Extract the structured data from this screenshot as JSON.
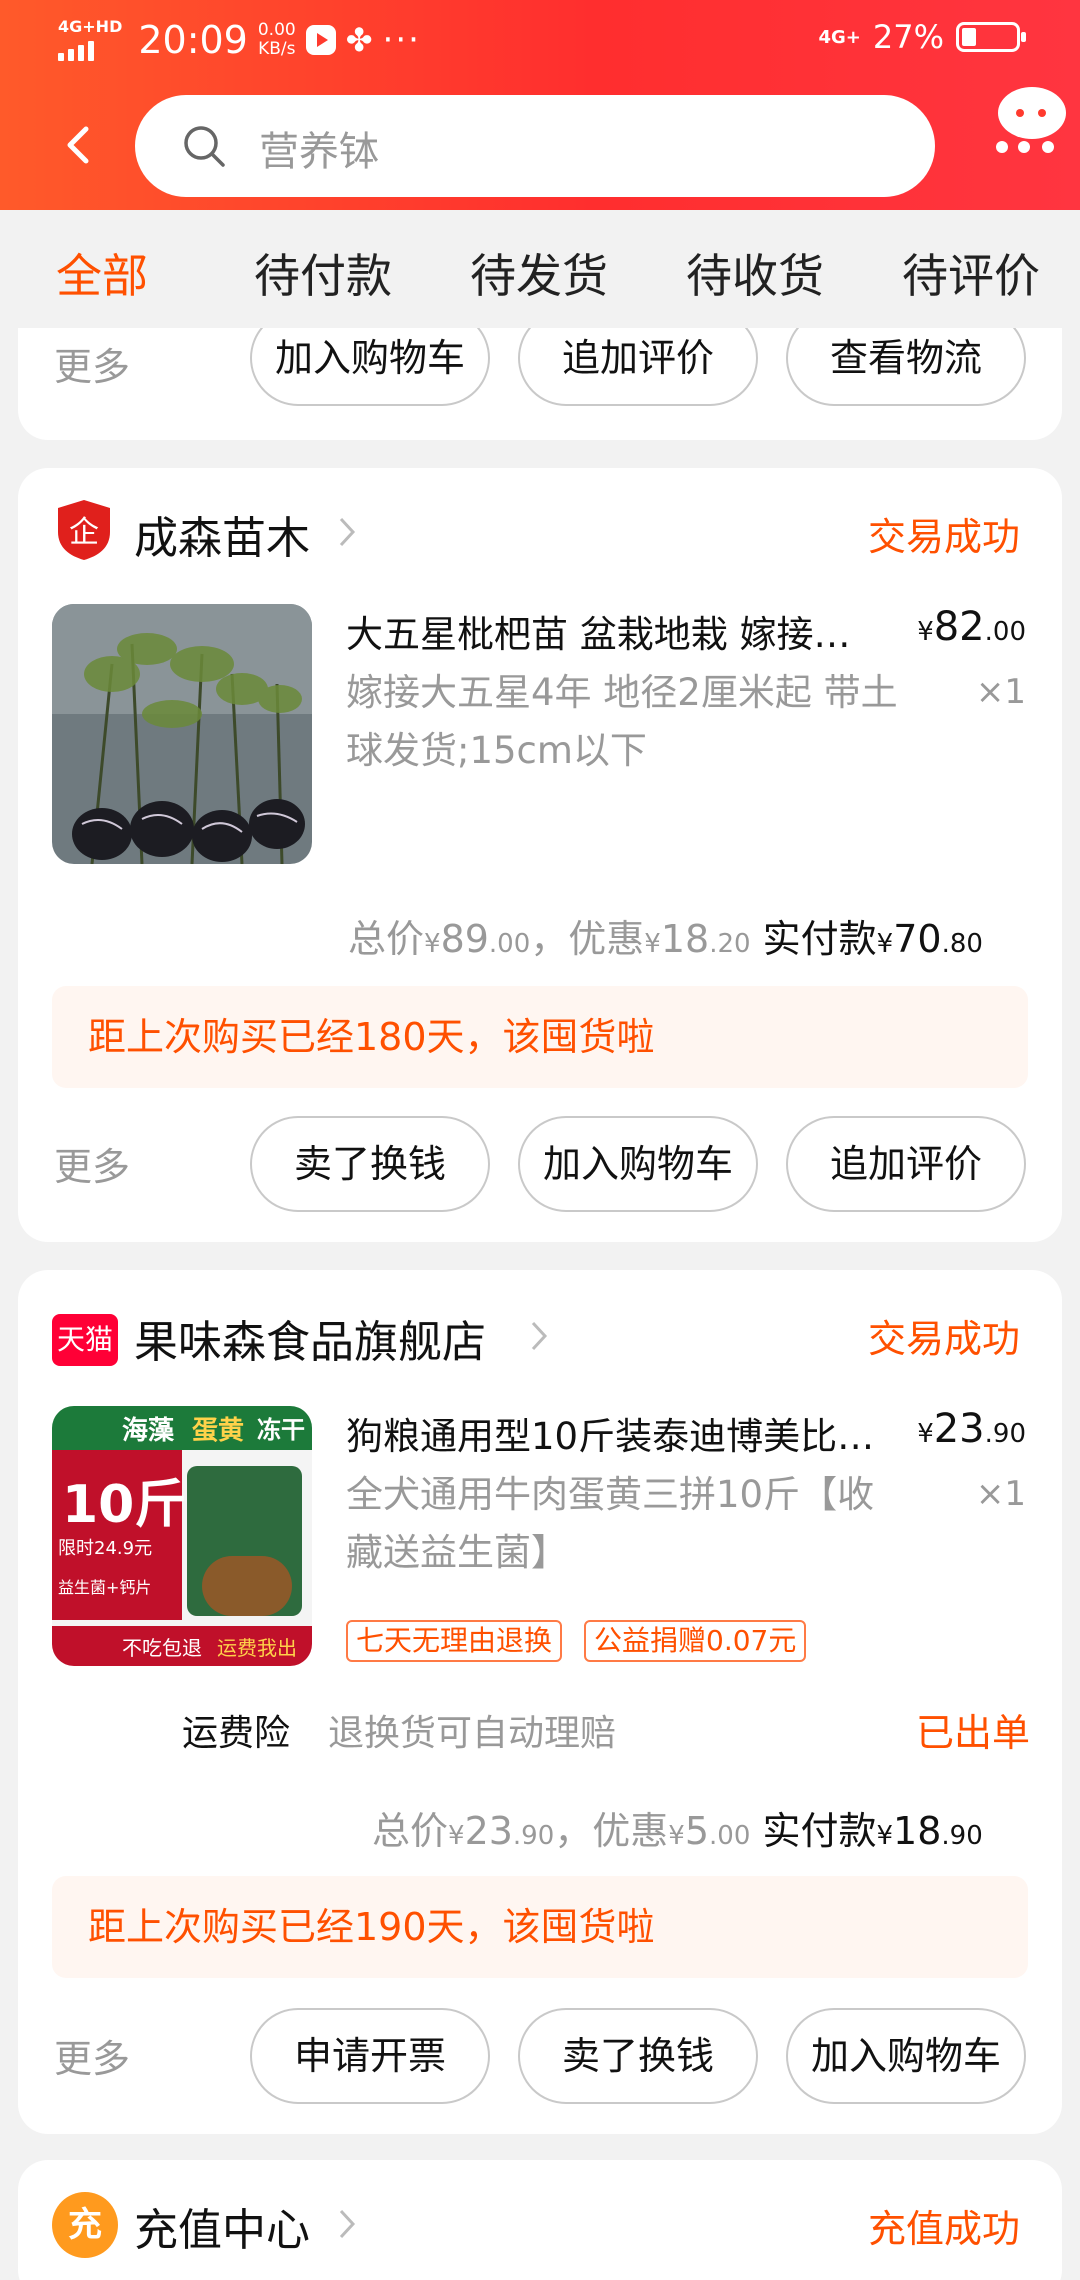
{
  "status_bar": {
    "network_left": "4G+HD",
    "time": "20:09",
    "speed_value": "0.00",
    "speed_unit": "KB/s",
    "network_right": "4G+",
    "battery": "27%"
  },
  "search": {
    "placeholder": "营养钵"
  },
  "tabs": [
    "全部",
    "待付款",
    "待发货",
    "待收货",
    "待评价"
  ],
  "cards": [
    {
      "more": "更多",
      "buttons": [
        "加入购物车",
        "追加评价",
        "查看物流"
      ]
    },
    {
      "shop": "成森苗木",
      "status": "交易成功",
      "product_title": "大五星枇杷苗 盆栽地栽 嫁接…",
      "product_sku": "嫁接大五星4年 地径2厘米起 带土球发货;15cm以下",
      "price_yen": "¥",
      "price_int": "82",
      "price_dec": ".00",
      "qty": "×1",
      "totals": {
        "total_label": "总价",
        "total_int": "89",
        "total_dec": ".00",
        "discount_label": "，优惠",
        "discount_int": "18",
        "discount_dec": ".20",
        "paid_label": "实付款",
        "paid_int": "70",
        "paid_dec": ".80"
      },
      "notice": "距上次购买已经180天，该囤货啦",
      "more": "更多",
      "buttons": [
        "卖了换钱",
        "加入购物车",
        "追加评价"
      ]
    },
    {
      "shop": "果味森食品旗舰店",
      "shop_logo_text": "天猫",
      "status": "交易成功",
      "product_title": "狗粮通用型10斤装泰迪博美比…",
      "product_sku": "全犬通用牛肉蛋黄三拼10斤【收藏送益生菌】",
      "price_yen": "¥",
      "price_int": "23",
      "price_dec": ".90",
      "qty": "×1",
      "tags": [
        "七天无理由退换",
        "公益捐赠0.07元"
      ],
      "insurance_label": "运费险",
      "insurance_desc": "退换货可自动理赔",
      "insurance_status": "已出单",
      "totals": {
        "total_label": "总价",
        "total_int": "23",
        "total_dec": ".90",
        "discount_label": "，优惠",
        "discount_int": "5",
        "discount_dec": ".00",
        "paid_label": "实付款",
        "paid_int": "18",
        "paid_dec": ".90"
      },
      "notice": "距上次购买已经190天，该囤货啦",
      "more": "更多",
      "buttons": [
        "申请开票",
        "卖了换钱",
        "加入购物车"
      ],
      "thumb_texts": {
        "t1": "海藻",
        "t2": "蛋黄",
        "t3": "冻干",
        "weight": "10斤",
        "price": "限时24.9元",
        "extra": "益生菌+钙片",
        "bottom1": "不吃包退",
        "bottom2": "运费我出"
      }
    },
    {
      "shop": "充值中心",
      "shop_logo_text": "充",
      "status": "充值成功"
    }
  ],
  "colors": {
    "accent": "#ff5000",
    "header_start": "#ff5a2a",
    "header_end": "#ff3540"
  }
}
